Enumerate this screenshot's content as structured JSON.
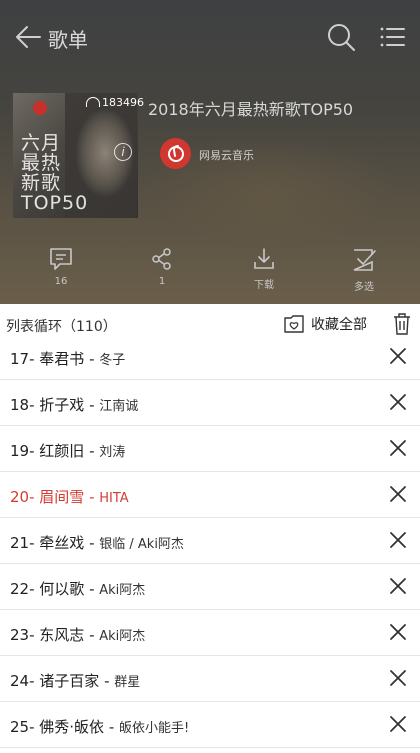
{
  "header": {
    "back_icon": "back-arrow-icon",
    "title": "歌单",
    "search_icon": "search-icon",
    "menu_icon": "menu-icon"
  },
  "playlist": {
    "cover_title_lines": [
      "六月",
      "最热",
      "新歌",
      "TOP50"
    ],
    "play_count": "183496",
    "name": "2018年六月最热新歌TOP50",
    "creator": "网易云音乐",
    "brand_color": "#d0372f"
  },
  "actions": [
    {
      "icon": "comment-icon",
      "label": "16"
    },
    {
      "icon": "share-icon",
      "label": "1"
    },
    {
      "icon": "download-icon",
      "label": "下载"
    },
    {
      "icon": "multi-select-icon",
      "label": "多选"
    }
  ],
  "list_header": {
    "loop_mode": "列表循环（110）",
    "favorite_all": "收藏全部"
  },
  "songs": [
    {
      "index": "17-",
      "title": "奉君书",
      "artist": "冬子",
      "active": false
    },
    {
      "index": "18-",
      "title": "折子戏",
      "artist": "江南诚",
      "active": false
    },
    {
      "index": "19-",
      "title": "红颜旧",
      "artist": "刘涛",
      "active": false
    },
    {
      "index": "20-",
      "title": "眉间雪",
      "artist": "HITA",
      "active": true
    },
    {
      "index": "21-",
      "title": "牵丝戏",
      "artist": "银临 / Aki阿杰",
      "active": false
    },
    {
      "index": "22-",
      "title": "何以歌",
      "artist": "Aki阿杰",
      "active": false
    },
    {
      "index": "23-",
      "title": "东风志",
      "artist": "Aki阿杰",
      "active": false
    },
    {
      "index": "24-",
      "title": "诸子百家",
      "artist": "群星",
      "active": false
    },
    {
      "index": "25-",
      "title": "佛秀·皈依",
      "artist": "皈依小能手!",
      "active": false
    }
  ],
  "colors": {
    "active": "#d43c33",
    "header_text": "#d9d9d9"
  }
}
